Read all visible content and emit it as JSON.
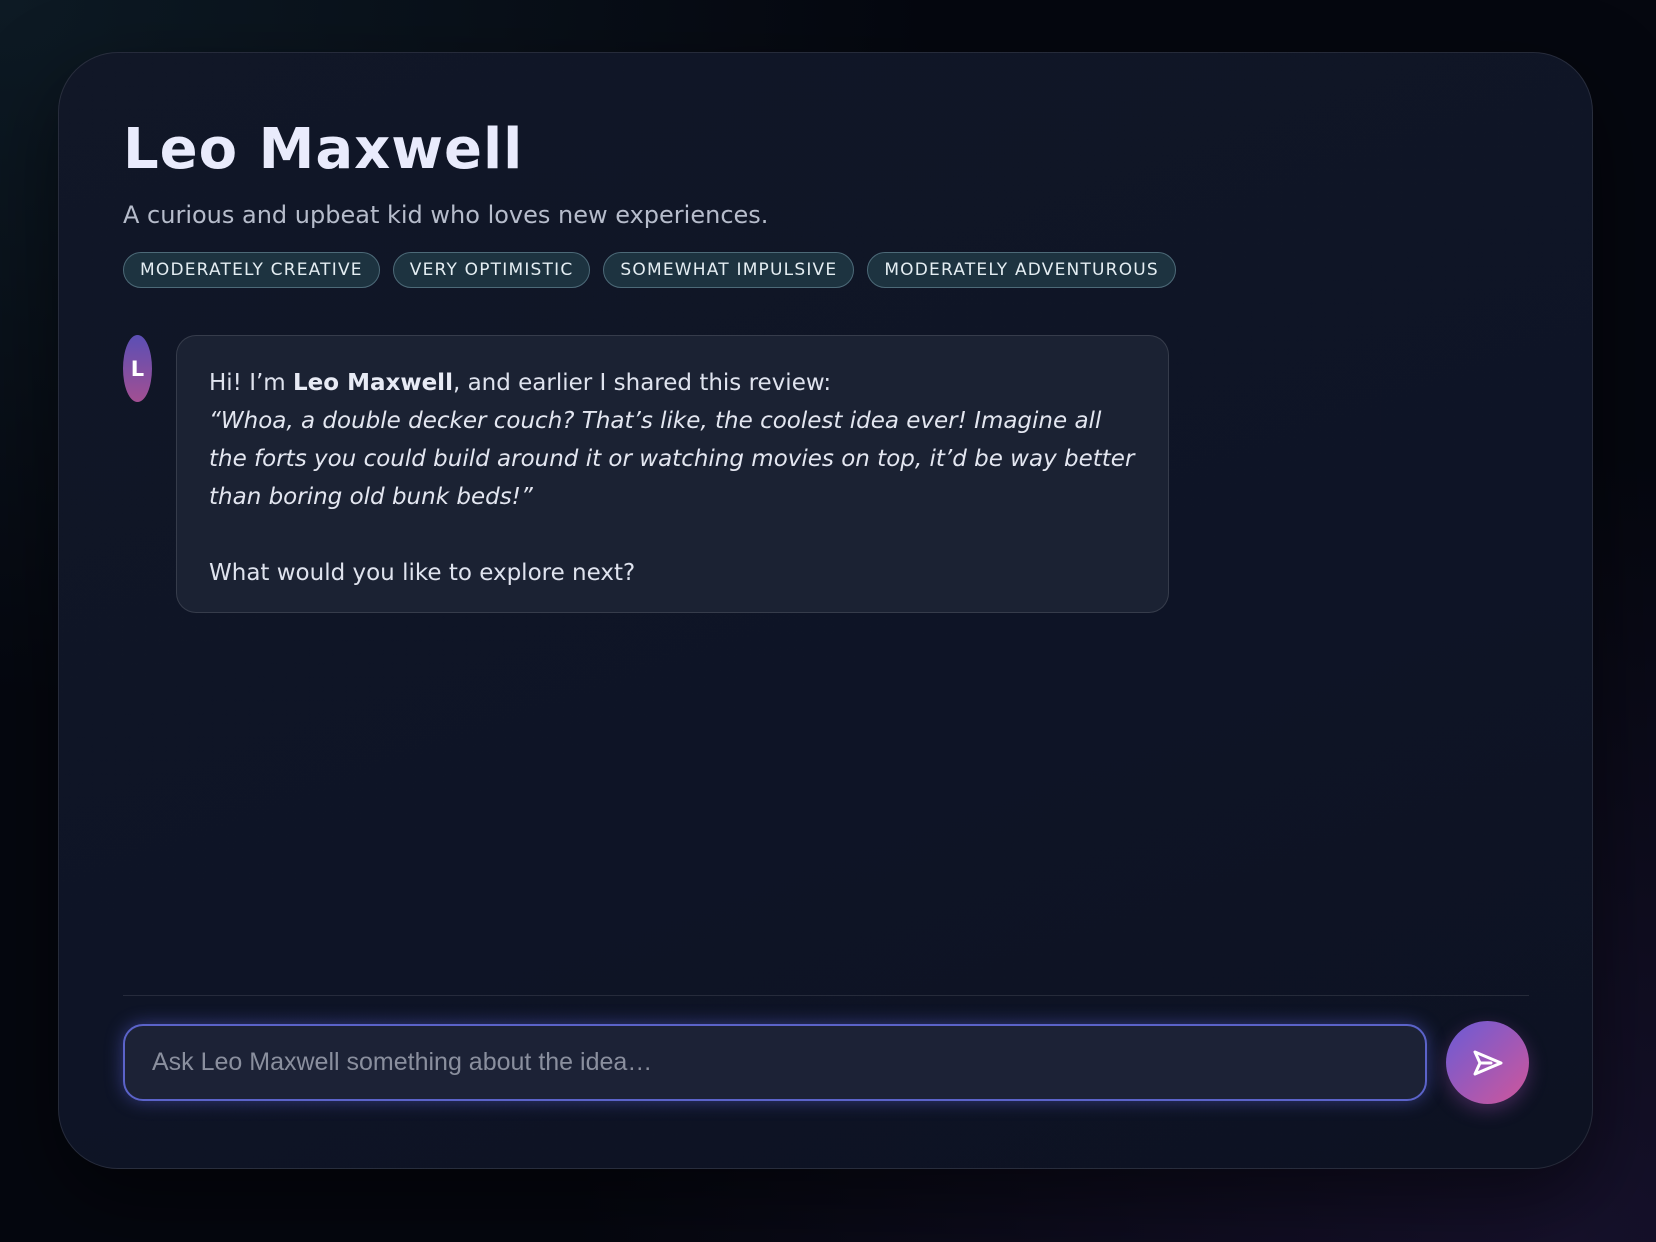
{
  "profile": {
    "name": "Leo Maxwell",
    "tagline": "A curious and upbeat kid who loves new experiences.",
    "tags": [
      "MODERATELY CREATIVE",
      "VERY OPTIMISTIC",
      "SOMEWHAT IMPULSIVE",
      "MODERATELY ADVENTUROUS"
    ],
    "avatar_initial": "L"
  },
  "message": {
    "intro_prefix": "Hi! I’m ",
    "intro_name": "Leo Maxwell",
    "intro_suffix": ", and earlier I shared this review:",
    "quote": "“Whoa, a double decker couch? That’s like, the coolest idea ever! Imagine all the forts you could build around it or watching movies on top, it’d be way better than boring old bunk beds!”",
    "closing": "What would you like to explore next?"
  },
  "composer": {
    "placeholder": "Ask Leo Maxwell something about the idea…",
    "value": "",
    "send_icon": "send-icon"
  },
  "colors": {
    "accent_start": "#6a5bd6",
    "accent_end": "#d0569a",
    "tag_bg": "#1d3340",
    "input_border": "#5b63c9"
  }
}
